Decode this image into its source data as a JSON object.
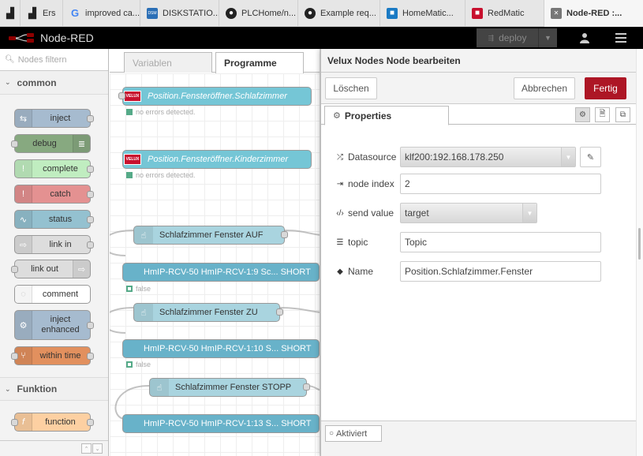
{
  "browser_tabs": [
    {
      "label": "",
      "fav_color": "#222",
      "fav_glyph": "▟"
    },
    {
      "label": "Ers",
      "fav_color": "#222",
      "fav_glyph": "▟"
    },
    {
      "label": "improved ca...",
      "fav_color": "#fff",
      "fav_glyph": "G"
    },
    {
      "label": "DISKSTATIO...",
      "fav_color": "#2b6fb6",
      "fav_glyph": "DSM"
    },
    {
      "label": "PLCHome/n...",
      "fav_color": "#222",
      "fav_glyph": "●"
    },
    {
      "label": "Example req...",
      "fav_color": "#222",
      "fav_glyph": "●"
    },
    {
      "label": "HomeMatic...",
      "fav_color": "#1a7ac4",
      "fav_glyph": "■"
    },
    {
      "label": "RedMatic",
      "fav_color": "#c8102e",
      "fav_glyph": "■"
    },
    {
      "label": "Node-RED :...",
      "fav_color": "#777",
      "fav_glyph": "✕"
    }
  ],
  "header": {
    "app_name": "Node-RED",
    "deploy_label": "deploy"
  },
  "palette": {
    "filter_placeholder": "Nodes filtern",
    "categories": [
      "common",
      "Funktion"
    ],
    "nodes": [
      {
        "label": "inject",
        "color": "#a6bbcf",
        "icon": "⇆"
      },
      {
        "label": "debug",
        "color": "#87a980",
        "icon": "≣"
      },
      {
        "label": "complete",
        "color": "#c0edc0",
        "icon": "!"
      },
      {
        "label": "catch",
        "color": "#e49191",
        "icon": "!"
      },
      {
        "label": "status",
        "color": "#94c1d0",
        "icon": "∿"
      },
      {
        "label": "link in",
        "color": "#dddddd",
        "icon": "⇨"
      },
      {
        "label": "link out",
        "color": "#dddddd",
        "icon": "⇨"
      },
      {
        "label": "comment",
        "color": "#ffffff",
        "icon": "◌"
      },
      {
        "label": "inject\nenhanced",
        "color": "#a6bbcf",
        "icon": "⚙"
      },
      {
        "label": "within time",
        "color": "#e2905e",
        "icon": "⑂"
      },
      {
        "label": "function",
        "color": "#fdd0a2",
        "icon": "f"
      }
    ]
  },
  "workspace": {
    "tabs": [
      "Variablen",
      "Programme"
    ],
    "flow_nodes": [
      {
        "label": "Position.Fensteröffner.Schlafzimmer",
        "status": "no errors detected."
      },
      {
        "label": "Position.Fensteröffner.Kinderzimmer",
        "status": "no errors detected."
      },
      {
        "label": "Schlafzimmer Fenster AUF"
      },
      {
        "label": "HmIP-RCV-50 HmIP-RCV-1:9 Sc... SHORT",
        "status": "false"
      },
      {
        "label": "Schlafzimmer Fenster ZU"
      },
      {
        "label": "HmIP-RCV-50 HmIP-RCV-1:10 S... SHORT",
        "status": "false"
      },
      {
        "label": "Schlafzimmer Fenster STOPP"
      },
      {
        "label": "HmIP-RCV-50 HmIP-RCV-1:13 S... SHORT"
      }
    ],
    "velux_badge": "VELUX"
  },
  "editor": {
    "title": "Velux Nodes Node bearbeiten",
    "delete_label": "Löschen",
    "cancel_label": "Abbrechen",
    "done_label": "Fertig",
    "properties_tab": "Properties",
    "fields": {
      "datasource_label": "Datasource",
      "datasource_value": "klf200:192.168.178.250",
      "node_index_label": "node index",
      "node_index_value": "2",
      "send_value_label": "send value",
      "send_value_value": "target",
      "topic_label": "topic",
      "topic_value": "Topic",
      "name_label": "Name",
      "name_value": "Position.Schlafzimmer.Fenster"
    },
    "enabled_label": "Aktiviert"
  },
  "colors": {
    "accent": "#ad1625",
    "header_bg": "#000000",
    "velux_node": "#75c6d6",
    "hmip_node": "#68b2c9",
    "button_node": "#a9d4df"
  }
}
